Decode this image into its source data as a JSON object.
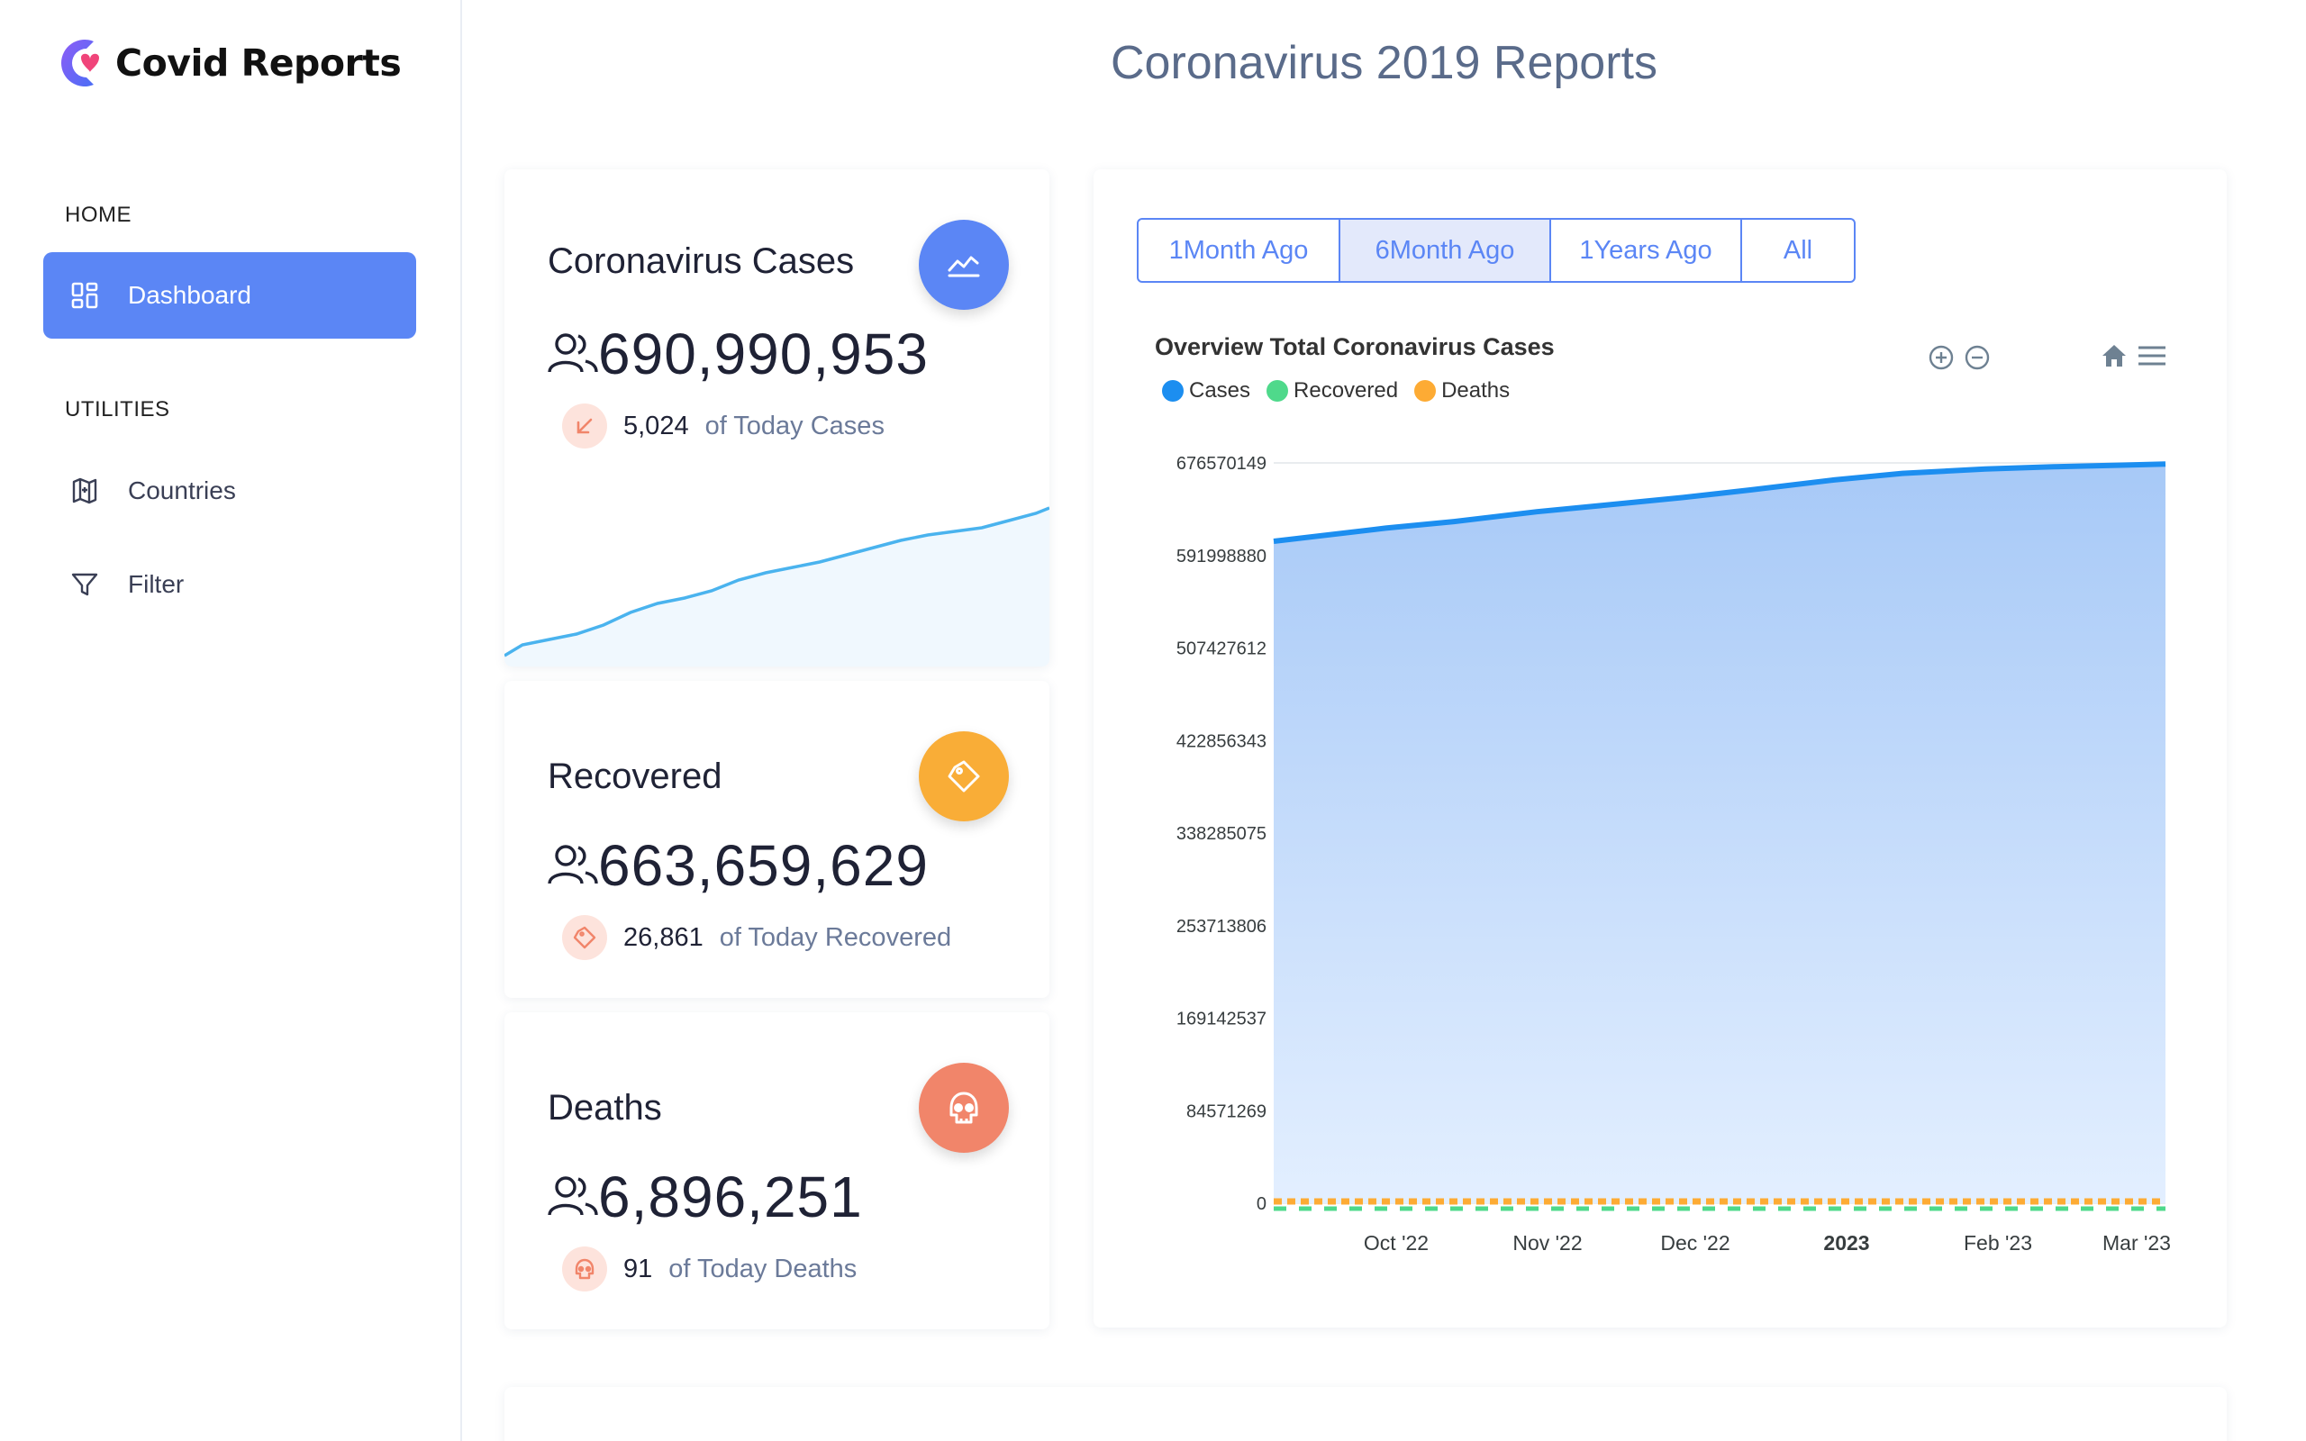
{
  "app": {
    "name": "Covid Reports"
  },
  "sidebar": {
    "home_header": "HOME",
    "utilities_header": "UTILITIES",
    "items": [
      {
        "label": "Dashboard",
        "icon": "dashboard-icon",
        "active": true
      },
      {
        "label": "Countries",
        "icon": "countries-icon",
        "active": false
      },
      {
        "label": "Filter",
        "icon": "filter-icon",
        "active": false
      }
    ]
  },
  "page": {
    "title": "Coronavirus 2019 Reports"
  },
  "stats": [
    {
      "title": "Coronavirus Cases",
      "value": "690,990,953",
      "today_value": "5,024",
      "today_label": "of Today Cases",
      "color": "#5b86f5",
      "icon": "trend-chart-icon",
      "sub_icon": "arrow-down-left-icon"
    },
    {
      "title": "Recovered",
      "value": "663,659,629",
      "today_value": "26,861",
      "today_label": "of Today Recovered",
      "color": "#f9ad37",
      "icon": "tag-icon",
      "sub_icon": "tag-icon"
    },
    {
      "title": "Deaths",
      "value": "6,896,251",
      "today_value": "91",
      "today_label": "of Today Deaths",
      "color": "#f1856a",
      "icon": "skull-icon",
      "sub_icon": "skull-icon"
    }
  ],
  "range_tabs": [
    {
      "label": "1Month Ago",
      "selected": false
    },
    {
      "label": "6Month Ago",
      "selected": true
    },
    {
      "label": "1Years Ago",
      "selected": false
    },
    {
      "label": "All",
      "selected": false
    }
  ],
  "colors": {
    "accent": "#5b86f5",
    "cases": "#1c8ef0",
    "recovered": "#4fd98b",
    "deaths": "#fdab34"
  },
  "chart_data": {
    "type": "area",
    "title": "Overview Total Coronavirus Cases",
    "legend": [
      "Cases",
      "Recovered",
      "Deaths"
    ],
    "legend_position": "top-left",
    "x_labels": [
      "Oct '22",
      "Nov '22",
      "Dec '22",
      "2023",
      "Feb '23",
      "Mar '23"
    ],
    "y_ticks": [
      "676570149",
      "591998880",
      "507427612",
      "422856343",
      "338285075",
      "253713806",
      "169142537",
      "84571269",
      "0"
    ],
    "ylim": [
      0,
      676570149
    ],
    "grid": true,
    "series": [
      {
        "name": "Cases",
        "x": [
          "2022-09-08",
          "2022-10-01",
          "2022-10-15",
          "2022-11-01",
          "2022-11-15",
          "2022-12-01",
          "2022-12-15",
          "2023-01-01",
          "2023-01-15",
          "2023-02-01",
          "2023-02-15",
          "2023-03-01",
          "2023-03-10"
        ],
        "values": [
          605000000,
          617000000,
          623000000,
          632000000,
          638000000,
          645000000,
          652000000,
          661000000,
          667000000,
          671000000,
          673000000,
          674500000,
          675500000
        ]
      },
      {
        "name": "Recovered",
        "values_approx": 0
      },
      {
        "name": "Deaths",
        "values_approx": 0
      }
    ]
  },
  "chart_toolbar": [
    "zoom-in-icon",
    "zoom-out-icon",
    "reset-home-icon",
    "menu-icon"
  ]
}
